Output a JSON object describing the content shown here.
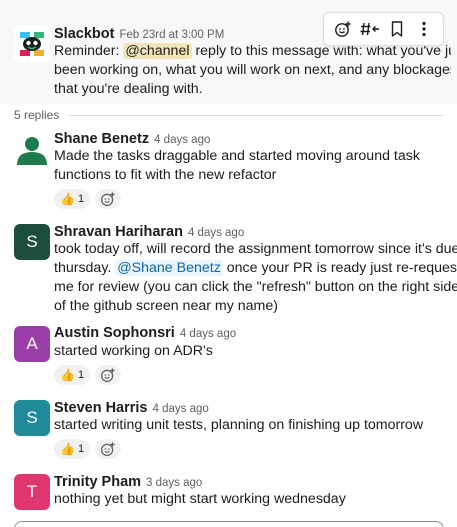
{
  "parent": {
    "author": "Slackbot",
    "timestamp": "Feb 23rd at 3:00 PM",
    "text_before": "Reminder: ",
    "mention": "@channel",
    "line1_after": " reply to this message with: what you've just",
    "line2": "been working on, what you will work on next, and any blockages",
    "line3": "that you're dealing with."
  },
  "toolbar": {
    "icons": [
      "add-reaction-icon",
      "forward-channel-icon",
      "bookmark-icon",
      "more-actions-icon"
    ]
  },
  "thread": {
    "reply_count_label": "5 replies"
  },
  "replies": [
    {
      "author": "Shane Benetz",
      "timestamp": "4 days ago",
      "avatar_letter": "",
      "avatar_color": "#2e8b57",
      "lines": [
        "Made the tasks draggable and started moving around task",
        "functions to fit with the new refactor"
      ],
      "reaction": {
        "emoji": "👍",
        "count": "1"
      }
    },
    {
      "author": "Shravan Hariharan",
      "timestamp": "4 days ago",
      "avatar_letter": "S",
      "avatar_color": "#1d4e3c",
      "line1": "took today off, will record the assignment tomorrow since it's due",
      "line2_before": "thursday. ",
      "line2_mention": "@Shane Benetz",
      "line2_after": " once your PR is ready just re-request",
      "line3": "me for review (you can click the \"refresh\" button on the right side",
      "line4": "of the github screen near my name)"
    },
    {
      "author": "Austin Sophonsri",
      "timestamp": "4 days ago",
      "avatar_letter": "A",
      "avatar_color": "#9b3fa8",
      "lines": [
        "started working on ADR's"
      ],
      "reaction": {
        "emoji": "👍",
        "count": "1"
      }
    },
    {
      "author": "Steven Harris",
      "timestamp": "4 days ago",
      "avatar_letter": "S",
      "avatar_color": "#1e8a9a",
      "lines": [
        "started writing unit tests, planning on finishing up tomorrow"
      ],
      "reaction": {
        "emoji": "👍",
        "count": "1"
      }
    },
    {
      "author": "Trinity Pham",
      "timestamp": "3 days ago",
      "avatar_letter": "T",
      "avatar_color": "#e0356e",
      "lines": [
        "nothing yet but might start working wednesday"
      ]
    }
  ],
  "colors": {
    "mention_bg": "#f2e5b8",
    "user_mention_text": "#1264a3",
    "muted_text": "#616061"
  }
}
